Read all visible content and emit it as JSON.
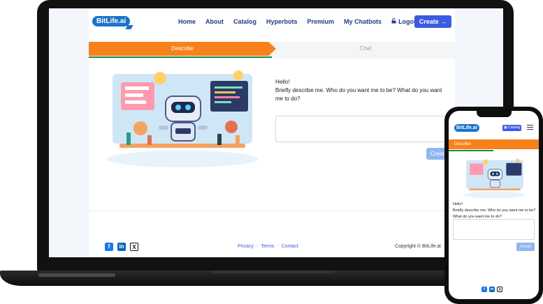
{
  "laptop": {
    "nav": {
      "logo": "BitLife.ai",
      "links": [
        "Home",
        "About",
        "Catalog",
        "Hyperbots",
        "Premium",
        "My Chatbots"
      ],
      "logout": "Logout",
      "create": "Create →"
    },
    "tabs": {
      "describe": "Describe",
      "chat": "Chat"
    },
    "prompt": {
      "greeting": "Hello!",
      "question": "Briefly describe me. Who do you want me to be? What do you want me to do?"
    },
    "send_label": "Create",
    "footer": {
      "social": [
        "f",
        "in",
        "X"
      ],
      "links": [
        "Privacy",
        "Terms",
        "Contact"
      ],
      "separator": "-",
      "copyright": "Copyright © BitLife.ai"
    }
  },
  "phone": {
    "logo": "BitLife.ai",
    "catalog": "▦ Catalog",
    "tab": "Describe",
    "prompt": {
      "greeting": "Hello!",
      "question": "Briefly describe me. Who do you want me to be? What do you want me to do?"
    },
    "send_label": "Create",
    "social": [
      "f",
      "in",
      "X"
    ]
  },
  "colors": {
    "accent": "#3b5be0",
    "orange": "#f7821b",
    "green": "#1f8a3a",
    "brand": "#1a73c9"
  },
  "icons": [
    "logout-icon",
    "arrow-right-icon",
    "facebook-icon",
    "linkedin-icon",
    "x-icon",
    "hamburger-menu-icon",
    "catalog-icon"
  ]
}
